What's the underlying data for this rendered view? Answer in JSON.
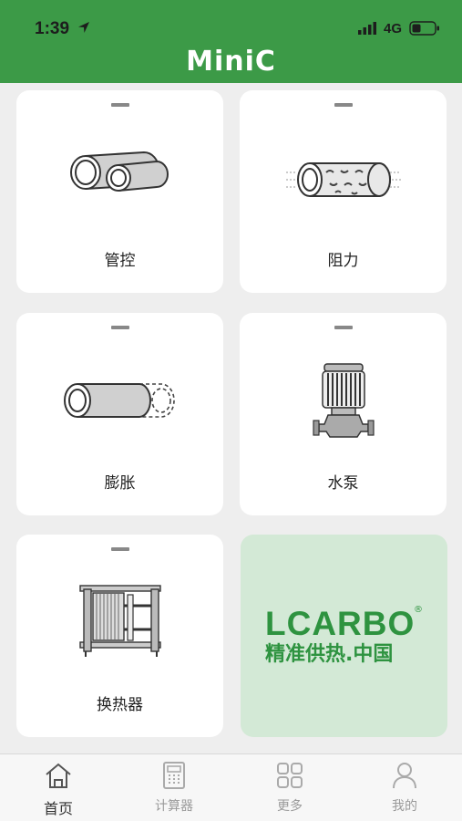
{
  "status_bar": {
    "time": "1:39",
    "network": "4G"
  },
  "header": {
    "title": "MiniC"
  },
  "cards": [
    {
      "label": "管控",
      "icon": "pipe-icon"
    },
    {
      "label": "阻力",
      "icon": "pipe-flow-icon"
    },
    {
      "label": "膨胀",
      "icon": "pipe-expansion-icon"
    },
    {
      "label": "水泵",
      "icon": "water-pump-icon"
    },
    {
      "label": "换热器",
      "icon": "heat-exchanger-icon"
    }
  ],
  "brand": {
    "name": "LCARBO",
    "registered": "®",
    "tagline": "精准供热.中国",
    "color": "#2e9340"
  },
  "tabs": [
    {
      "label": "首页",
      "icon": "home-icon",
      "active": true
    },
    {
      "label": "计算器",
      "icon": "calculator-icon",
      "active": false
    },
    {
      "label": "更多",
      "icon": "grid-icon",
      "active": false
    },
    {
      "label": "我的",
      "icon": "user-icon",
      "active": false
    }
  ],
  "colors": {
    "header": "#3c9a47",
    "background": "#eeeeee",
    "brand_bg": "#d3e9d6"
  }
}
